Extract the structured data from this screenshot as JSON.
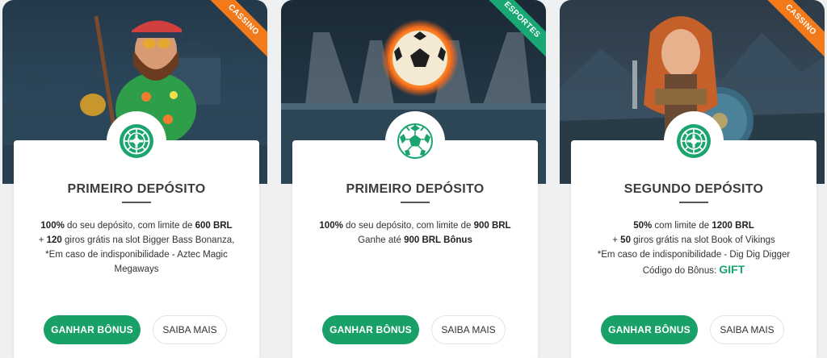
{
  "cards": [
    {
      "ribbon": "CASSINO",
      "title": "PRIMEIRO DEPÓSITO",
      "lines": [
        [
          {
            "b": true,
            "t": "100%"
          },
          {
            "b": false,
            "t": " do seu depósito, com limite de "
          },
          {
            "b": true,
            "t": "600 BRL"
          }
        ],
        [
          {
            "b": false,
            "t": "+ "
          },
          {
            "b": true,
            "t": "120"
          },
          {
            "b": false,
            "t": " giros grátis na slot Bigger Bass Bonanza,"
          }
        ],
        [
          {
            "b": false,
            "t": "*Em caso de indisponibilidade - Aztec Magic"
          }
        ],
        [
          {
            "b": false,
            "t": "Megaways"
          }
        ]
      ],
      "primary_button": "GANHAR BÔNUS",
      "secondary_button": "SAIBA MAIS",
      "icon": "roulette-icon"
    },
    {
      "ribbon": "ESPORTES",
      "title": "PRIMEIRO DEPÓSITO",
      "lines": [
        [
          {
            "b": true,
            "t": "100%"
          },
          {
            "b": false,
            "t": " do seu depósito, com limite de "
          },
          {
            "b": true,
            "t": "900 BRL"
          }
        ],
        [
          {
            "b": false,
            "t": "Ganhe até "
          },
          {
            "b": true,
            "t": "900 BRL Bônus"
          }
        ]
      ],
      "primary_button": "GANHAR BÔNUS",
      "secondary_button": "SAIBA MAIS",
      "icon": "soccer-ball-icon"
    },
    {
      "ribbon": "CASSINO",
      "title": "SEGUNDO DEPÓSITO",
      "lines": [
        [
          {
            "b": true,
            "t": "50%"
          },
          {
            "b": false,
            "t": " com limite de "
          },
          {
            "b": true,
            "t": "1200 BRL"
          }
        ],
        [
          {
            "b": false,
            "t": "+ "
          },
          {
            "b": true,
            "t": "50"
          },
          {
            "b": false,
            "t": " giros grátis na slot Book of Vikings"
          }
        ],
        [
          {
            "b": false,
            "t": "*Em caso de indisponibilidade - Dig Dig Digger"
          }
        ]
      ],
      "bonus_code_label": "Código do Bônus: ",
      "bonus_code": "GIFT",
      "primary_button": "GANHAR BÔNUS",
      "secondary_button": "SAIBA MAIS",
      "icon": "roulette-icon"
    }
  ],
  "colors": {
    "accent": "#19a066",
    "ribbon_casino": "#f27a1a",
    "ribbon_sports": "#19a874"
  }
}
